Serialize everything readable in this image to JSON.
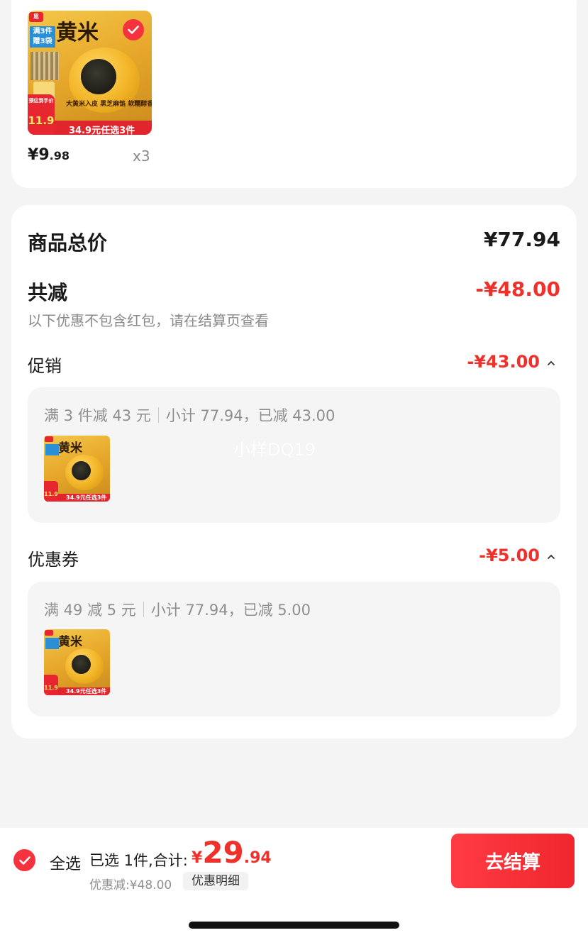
{
  "product": {
    "thumb_title": "黄米",
    "thumb_badge_top": "满3件",
    "thumb_badge_bottom": "赠3袋",
    "thumb_slogan": "大黄米入皮 黑芝麻馅 软糯醇香",
    "thumb_strip_label": "预估到手价",
    "thumb_strip_price": "11.9",
    "thumb_strip_promo": "34.9元任选3件",
    "price_currency": "¥",
    "price_int": "9",
    "price_dec": ".98",
    "quantity": "x3",
    "selected": true
  },
  "summary": {
    "total_label": "商品总价",
    "total_value": "¥77.94",
    "discount_label": "共减",
    "discount_value": "-¥48.00",
    "note": "以下优惠不包含红包，请在结算页查看",
    "promo": {
      "label": "促销",
      "value": "-¥43.00",
      "rule": "满 3 件减 43 元",
      "subtotal": "小计 77.94，已减 43.00"
    },
    "coupon": {
      "label": "优惠券",
      "value": "-¥5.00",
      "rule": "满 49 减 5 元",
      "subtotal": "小计 77.94，已减 5.00"
    },
    "watermark": "小样DQ19"
  },
  "bottom_bar": {
    "select_all": "全选",
    "selected_text": "已选 1件,合计:",
    "total_currency": "¥",
    "total_int": "29",
    "total_dec": ".94",
    "discount_text": "优惠减:¥48.00",
    "detail_button": "优惠明细",
    "checkout_button": "去结算"
  },
  "colors": {
    "accent_red": "#f0302a",
    "checkout_button": "#ff3b43",
    "background": "#f4f4f4"
  }
}
